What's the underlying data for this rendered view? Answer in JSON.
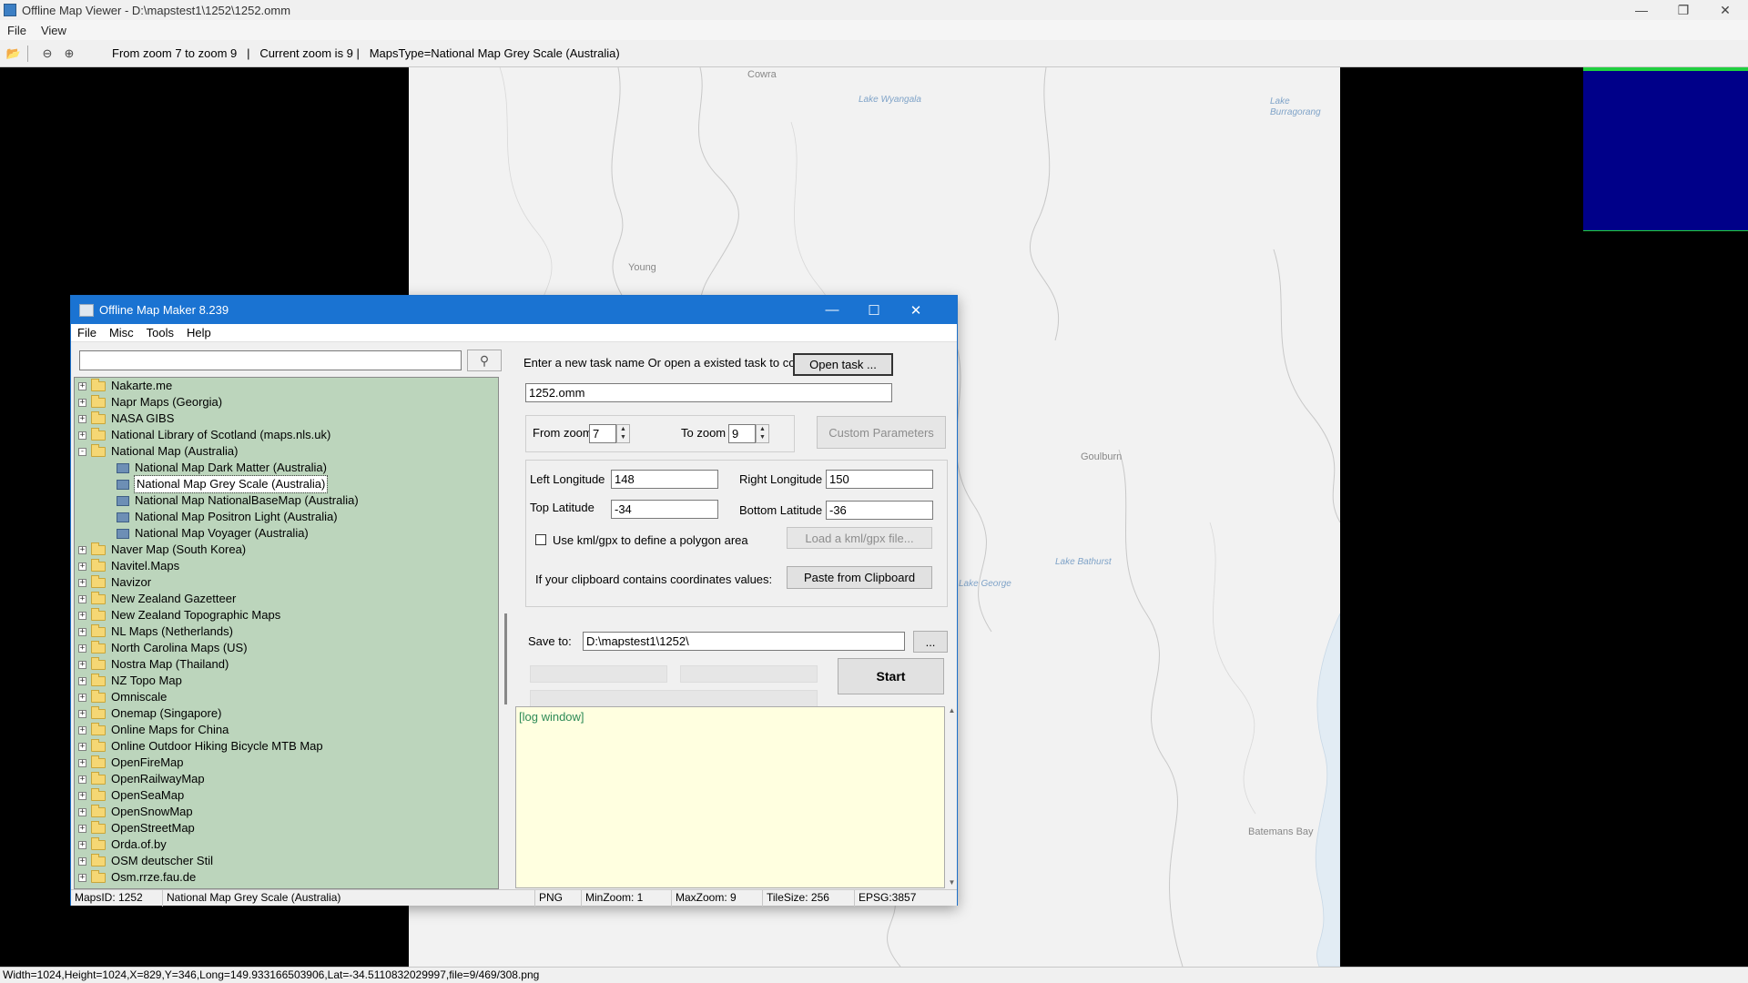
{
  "viewer": {
    "title": "Offline Map Viewer - D:\\mapstest1\\1252\\1252.omm",
    "menu": [
      "File",
      "View"
    ],
    "toolbar_info": "From zoom 7 to zoom 9   |   Current zoom is 9 |   MapsType=National Map Grey Scale (Australia)",
    "status": "Width=1024,Height=1024,X=829,Y=346,Long=149.933166503906,Lat=-34.5110832029997,file=9/469/308.png",
    "map_places": [
      {
        "name": "Cowra"
      },
      {
        "name": "Young"
      },
      {
        "name": "Goulburn"
      },
      {
        "name": "Batemans Bay"
      }
    ],
    "map_lakes": [
      {
        "name": "Lake Wyangala"
      },
      {
        "name": "Lake Burragorang"
      },
      {
        "name": "Lake George"
      },
      {
        "name": "Lake Bathurst"
      }
    ]
  },
  "dialog": {
    "title": "Offline Map Maker 8.239",
    "menu": [
      "File",
      "Misc",
      "Tools",
      "Help"
    ],
    "search_value": "",
    "tree": [
      {
        "label": "Nakarte.me",
        "type": "folder",
        "expanded": false
      },
      {
        "label": "Napr Maps (Georgia)",
        "type": "folder",
        "expanded": false
      },
      {
        "label": "NASA GIBS",
        "type": "folder",
        "expanded": false
      },
      {
        "label": "National Library of Scotland (maps.nls.uk)",
        "type": "folder",
        "expanded": false
      },
      {
        "label": "National Map (Australia)",
        "type": "folder",
        "expanded": true
      },
      {
        "label": "National Map Dark Matter (Australia)",
        "type": "map"
      },
      {
        "label": "National Map Grey Scale (Australia)",
        "type": "map",
        "selected": true
      },
      {
        "label": "National Map NationalBaseMap (Australia)",
        "type": "map"
      },
      {
        "label": "National Map Positron Light (Australia)",
        "type": "map"
      },
      {
        "label": "National Map Voyager (Australia)",
        "type": "map"
      },
      {
        "label": "Naver Map (South Korea)",
        "type": "folder",
        "expanded": false
      },
      {
        "label": "Navitel.Maps",
        "type": "folder",
        "expanded": false
      },
      {
        "label": "Navizor",
        "type": "folder",
        "expanded": false
      },
      {
        "label": "New Zealand Gazetteer",
        "type": "folder",
        "expanded": false
      },
      {
        "label": "New Zealand Topographic Maps",
        "type": "folder",
        "expanded": false
      },
      {
        "label": "NL Maps (Netherlands)",
        "type": "folder",
        "expanded": false
      },
      {
        "label": "North Carolina Maps (US)",
        "type": "folder",
        "expanded": false
      },
      {
        "label": "Nostra Map (Thailand)",
        "type": "folder",
        "expanded": false
      },
      {
        "label": "NZ Topo Map",
        "type": "folder",
        "expanded": false
      },
      {
        "label": "Omniscale",
        "type": "folder",
        "expanded": false
      },
      {
        "label": "Onemap (Singapore)",
        "type": "folder",
        "expanded": false
      },
      {
        "label": "Online Maps for China",
        "type": "folder",
        "expanded": false
      },
      {
        "label": "Online Outdoor Hiking Bicycle MTB Map",
        "type": "folder",
        "expanded": false
      },
      {
        "label": "OpenFireMap",
        "type": "folder",
        "expanded": false
      },
      {
        "label": "OpenRailwayMap",
        "type": "folder",
        "expanded": false
      },
      {
        "label": "OpenSeaMap",
        "type": "folder",
        "expanded": false
      },
      {
        "label": "OpenSnowMap",
        "type": "folder",
        "expanded": false
      },
      {
        "label": "OpenStreetMap",
        "type": "folder",
        "expanded": false
      },
      {
        "label": "Orda.of.by",
        "type": "folder",
        "expanded": false
      },
      {
        "label": "OSM deutscher Stil",
        "type": "folder",
        "expanded": false
      },
      {
        "label": "Osm.rrze.fau.de",
        "type": "folder",
        "expanded": false
      }
    ],
    "task_prompt": "Enter a new task name Or open a existed task to continue:",
    "open_task_label": "Open task ...",
    "task_name": "1252.omm",
    "from_zoom_label": "From zoom",
    "from_zoom": "7",
    "to_zoom_label": "To zoom",
    "to_zoom": "9",
    "custom_params_label": "Custom Parameters",
    "left_lon_label": "Left Longitude",
    "left_lon": "148",
    "right_lon_label": "Right Longitude",
    "right_lon": "150",
    "top_lat_label": "Top Latitude",
    "top_lat": "-34",
    "bottom_lat_label": "Bottom Latitude",
    "bottom_lat": "-36",
    "kml_checkbox_label": "Use kml/gpx to define a polygon area",
    "load_kml_label": "Load a kml/gpx file...",
    "clipboard_prompt": "If your clipboard contains coordinates values:",
    "paste_label": "Paste from Clipboard",
    "save_to_label": "Save to:",
    "save_to": "D:\\mapstest1\\1252\\",
    "browse_label": "...",
    "start_label": "Start",
    "log_text": "[log window]",
    "status": {
      "maps_id": "MapsID: 1252",
      "map_name": "National Map Grey Scale (Australia)",
      "format": "PNG",
      "min_zoom": "MinZoom: 1",
      "max_zoom": "MaxZoom: 9",
      "tile_size": "TileSize: 256",
      "epsg": "EPSG:3857"
    }
  }
}
